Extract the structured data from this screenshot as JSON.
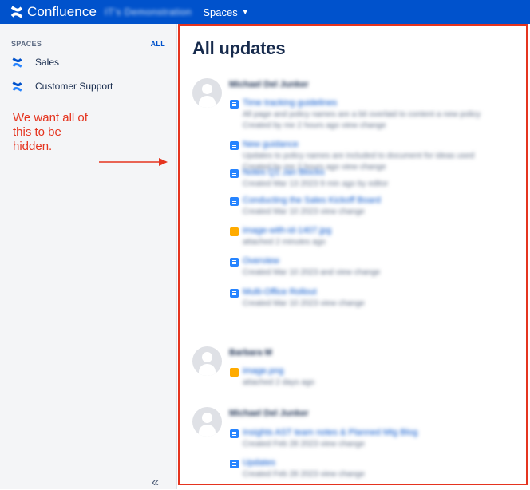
{
  "topbar": {
    "logo_text": "Confluence",
    "site_name": "IT's Demonstration",
    "spaces_label": "Spaces"
  },
  "sidebar": {
    "header": "SPACES",
    "all_label": "ALL",
    "items": [
      {
        "label": "Sales"
      },
      {
        "label": "Customer Support"
      }
    ],
    "collapse_glyph": "«"
  },
  "annotation": {
    "lines": [
      "We want all of",
      "this to be",
      "hidden."
    ]
  },
  "main": {
    "title": "All updates",
    "groups": [
      {
        "name": "Michael Del Junker",
        "updates": [
          {
            "icon": "page",
            "title": "Time tracking guidelines",
            "line2": "All page and policy names are a bit overlaid to content a new policy",
            "line3": "Created by me 2 hours ago view change"
          },
          {
            "icon": "page",
            "title": "New guidance",
            "line2": "Updates to policy names are included to document for ideas used",
            "line3": "Created by me 2 hours ago view change"
          },
          {
            "icon": "page",
            "title": "Notes Q1 Jan Blocks",
            "line2": "Created Mar 13 2023 9 min ago by editor",
            "line3": ""
          },
          {
            "icon": "page",
            "title": "Conducting the Sales Kickoff Board",
            "line2": "Created Mar 10 2023 view change",
            "line3": ""
          },
          {
            "icon": "img",
            "title": "image-with-id-1407.jpg",
            "line2": "attached 2 minutes ago",
            "line3": ""
          },
          {
            "icon": "page",
            "title": "Overview",
            "line2": "Created Mar 10 2023 and view change",
            "line3": ""
          },
          {
            "icon": "page",
            "title": "Multi-Office Rollout",
            "line2": "Created Mar 10 2023 view change",
            "line3": ""
          }
        ]
      },
      {
        "name": "Barbara M",
        "updates": [
          {
            "icon": "img",
            "title": "image.png",
            "line2": "attached 2 days ago",
            "line3": ""
          }
        ]
      },
      {
        "name": "Michael Del Junker",
        "updates": [
          {
            "icon": "page",
            "title": "Insights AST team notes & Planned Mtg Blog",
            "line2": "Created Feb 28 2023 view change",
            "line3": ""
          },
          {
            "icon": "page",
            "title": "Updates",
            "line2": "Created Feb 28 2023 view change",
            "line3": ""
          }
        ]
      }
    ]
  },
  "colors": {
    "brand": "#0052cc",
    "annotation": "#e5341f",
    "sidebar_bg": "#f4f5f7"
  }
}
